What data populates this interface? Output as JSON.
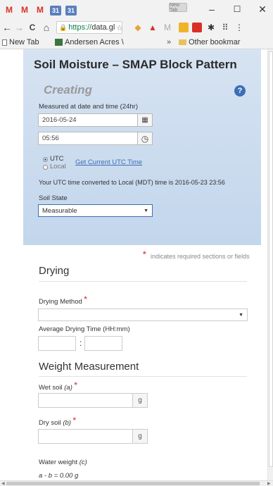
{
  "tabs": {
    "gmail_letter": "M",
    "calendar_letter": "31",
    "active_tab_label": "New Tab",
    "window_minimize": "–",
    "window_maximize": "☐",
    "window_close": "✕"
  },
  "toolbar": {
    "back": "←",
    "forward": "→",
    "reload": "C",
    "home": "⌂",
    "url_scheme": "https://",
    "url_rest": "data.gl",
    "star": "☆",
    "menu": "⋮"
  },
  "bookmarks": {
    "new_tab": "New Tab",
    "andersen": "Andersen Acres \\",
    "overflow": "»",
    "other": "Other bookmar"
  },
  "form": {
    "title": "Soil Moisture – SMAP Block Pattern",
    "status": "Creating",
    "help_icon": "?",
    "measured_label": "Measured at date and time (24hr)",
    "date_value": "2016-05-24",
    "calendar_icon": "▦",
    "time_value": "05:56",
    "clock_icon": "◷",
    "tz_utc": "UTC",
    "tz_local": "Local",
    "get_utc_link": "Get Current UTC Time",
    "converted_text": "Your UTC time converted to Local (MDT) time is 2016-05-23 23:56",
    "soil_state_label": "Soil State",
    "soil_state_value": "Measurable",
    "required_star": "*",
    "required_note": "indicates required sections or fields",
    "drying_heading": "Drying",
    "drying_method_label": "Drying Method",
    "drying_method_value": "",
    "avg_drying_label": "Average Drying Time (HH:mm)",
    "time_sep": ":",
    "weight_heading": "Weight Measurement",
    "wet_soil_label": "Wet soil",
    "wet_soil_var": "(a)",
    "wet_unit": "g",
    "dry_soil_label": "Dry soil",
    "dry_soil_var": "(b)",
    "dry_unit": "g",
    "water_weight_label": "Water weight",
    "water_weight_var": "(c)",
    "formula": "a - b = 0.00 g"
  },
  "colors": {
    "accent": "#3b6fb6",
    "required": "#d9534f",
    "hero_bg": "#c9daee"
  }
}
